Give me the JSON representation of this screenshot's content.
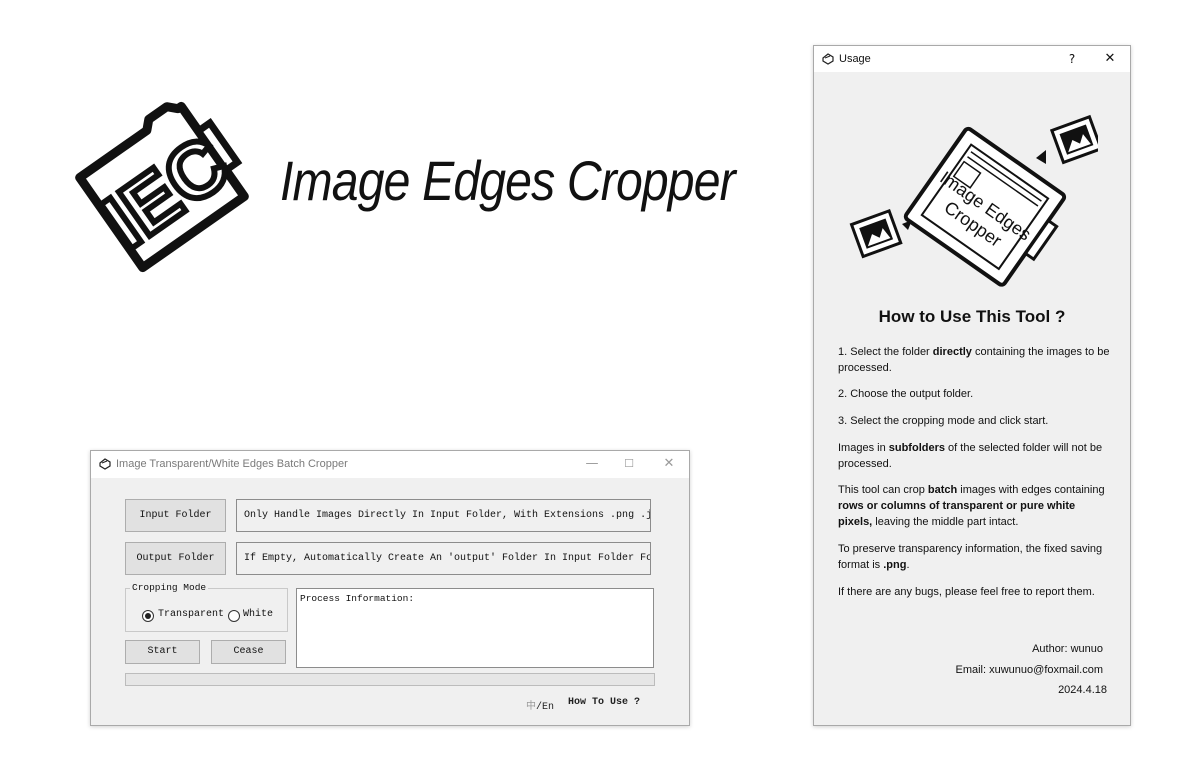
{
  "logo": {
    "mark_text": "IEC",
    "title": "Image Edges Cropper"
  },
  "main_window": {
    "title": "Image Transparent/White Edges Batch Cropper",
    "controls": {
      "minimize": "—",
      "maximize": "☐",
      "close": "✕"
    },
    "input_folder_button": "Input Folder",
    "input_folder_field": "Only Handle Images Directly In Input Folder, With Extensions .png .jpg .jpeg",
    "output_folder_button": "Output Folder",
    "output_folder_field": "If Empty, Automatically Create An 'output' Folder In Input Folder For Storage",
    "cropping_mode": {
      "label": "Cropping Mode",
      "options": [
        "Transparent",
        "White"
      ],
      "selected": "Transparent"
    },
    "process_info_label": "Process Information:",
    "start_button": "Start",
    "cease_button": "Cease",
    "progress": 0,
    "lang_zh": "中",
    "lang_sep": "/",
    "lang_en": "En",
    "how_to_use": "How To Use ?"
  },
  "usage_window": {
    "title": "Usage",
    "help_button": "?",
    "close_button": "✕",
    "illustration_text": [
      "Image Edges",
      "Cropper"
    ],
    "heading": "How to Use This Tool ?",
    "steps": [
      {
        "a": "1. Select the folder ",
        "b": "directly",
        "c": " containing the images to be processed."
      },
      {
        "a": "2. Choose the output folder."
      },
      {
        "a": "3. Select the cropping mode and click start."
      },
      {
        "a": "Images in ",
        "b": "subfolders",
        "c": " of the selected folder will not be processed."
      }
    ],
    "batch": {
      "a": "This tool can crop ",
      "b": "batch",
      "c": " images with edges containing ",
      "d": "rows or columns of transparent or pure white pixels,",
      "e": " leaving the middle part intact."
    },
    "transparency": {
      "a": "To preserve transparency information, the fixed saving format is ",
      "b": ".png",
      "c": "."
    },
    "bugs": "If there are any bugs, please feel free to report them.",
    "author": "Author: wunuo",
    "email": "Email: xuwunuo@foxmail.com",
    "date": "2024.4.18"
  }
}
